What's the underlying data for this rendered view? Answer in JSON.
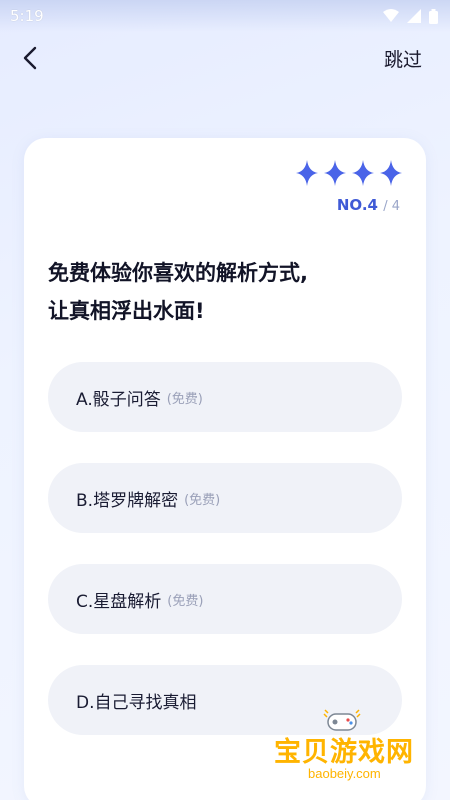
{
  "status_bar": {
    "time": "5:19"
  },
  "header": {
    "skip_label": "跳过"
  },
  "progress": {
    "current": "NO.4",
    "separator_total": "/ 4",
    "stars_filled": 4
  },
  "question": {
    "line1": "免费体验你喜欢的解析方式,",
    "line2": "让真相浮出水面!"
  },
  "options": [
    {
      "label": "A.骰子问答",
      "tag": "(免费)"
    },
    {
      "label": "B.塔罗牌解密",
      "tag": "(免费)"
    },
    {
      "label": "C.星盘解析",
      "tag": "(免费)"
    },
    {
      "label": "D.自己寻找真相",
      "tag": ""
    }
  ],
  "watermark": {
    "text": "宝贝游戏网",
    "url": "baobeiy.com"
  },
  "colors": {
    "accent": "#3f5ad6",
    "option_bg": "#f0f2f8",
    "star": "#4a64e8"
  }
}
